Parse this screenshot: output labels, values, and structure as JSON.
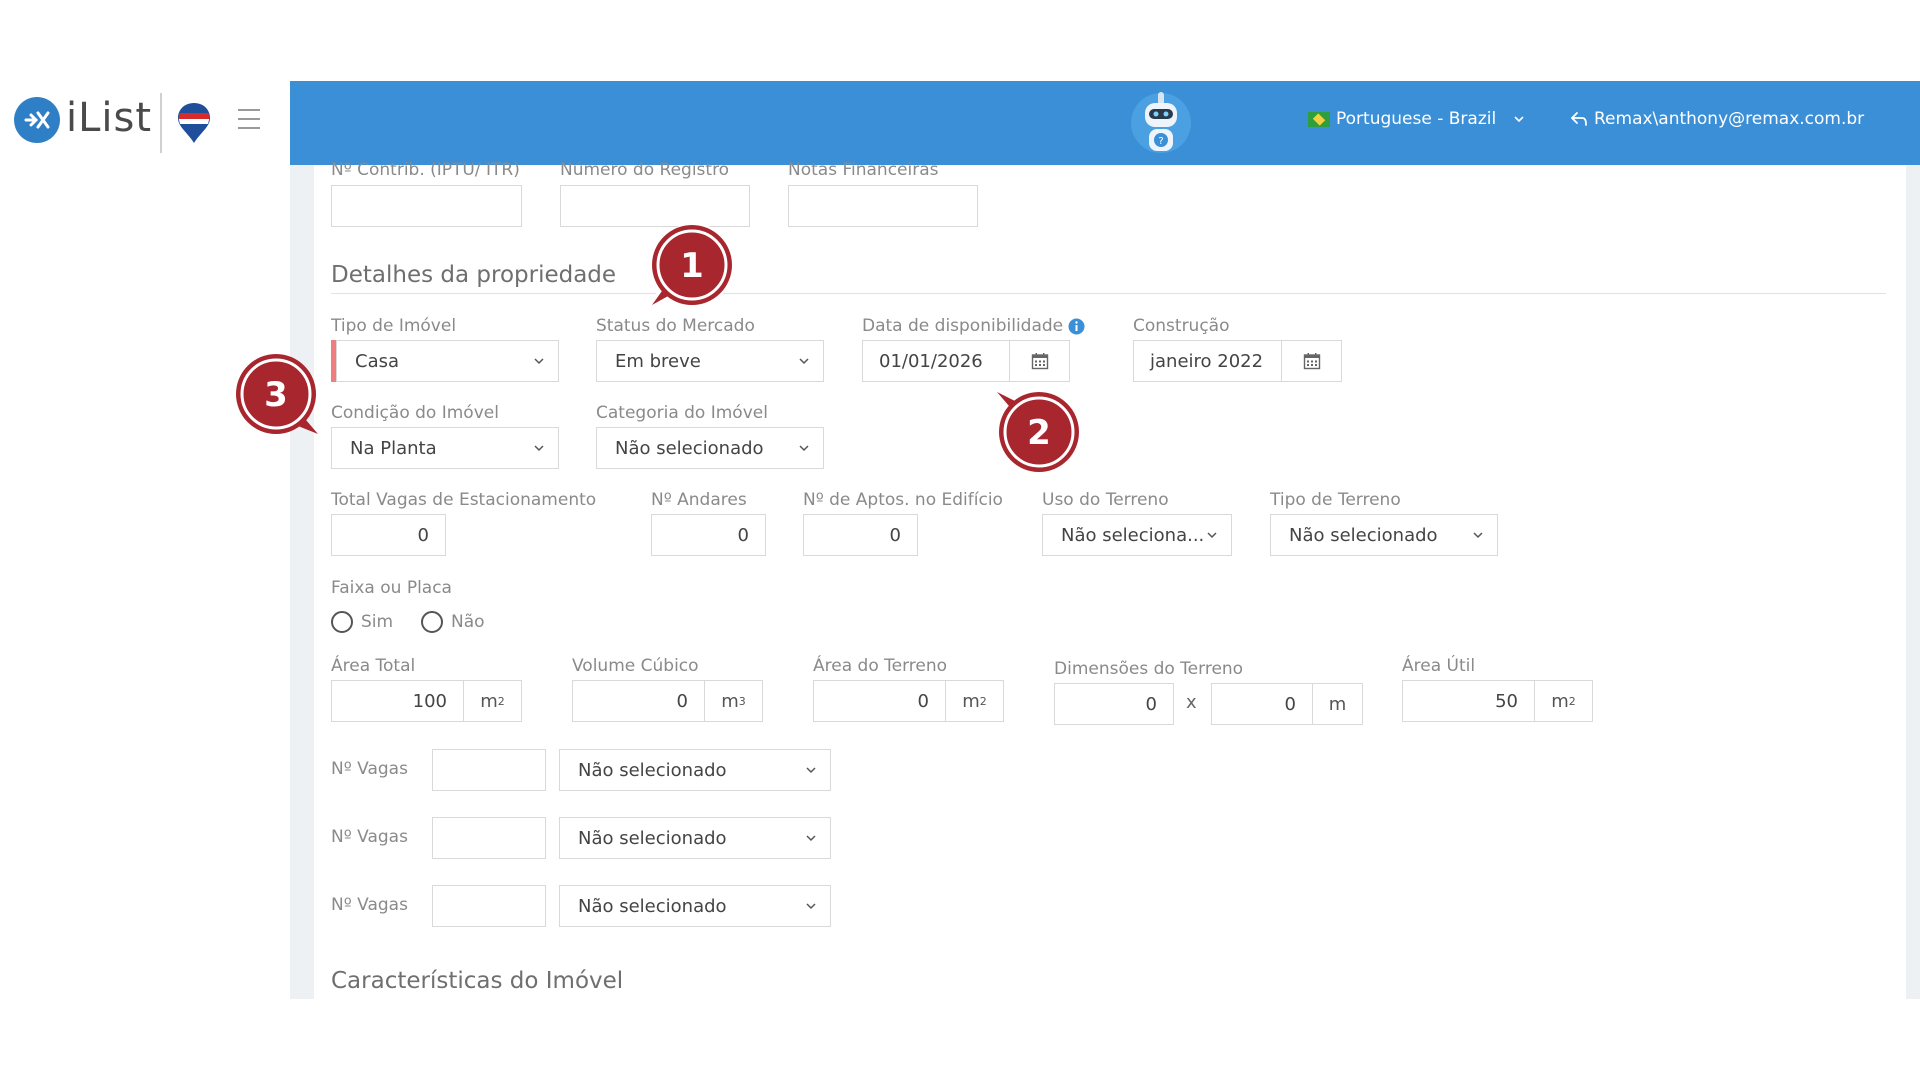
{
  "header": {
    "brand": "iList",
    "language": "Portuguese - Brazil",
    "user": "Remax\\anthony@remax.com.br"
  },
  "top_fields": {
    "contrib_label": "Nº Contrib. (IPTU/ ITR)",
    "registro_label": "Número do Registro",
    "notas_label": "Notas Financeiras"
  },
  "details": {
    "title": "Detalhes da propriedade",
    "tipo_label": "Tipo de Imóvel",
    "tipo_value": "Casa",
    "status_label": "Status do Mercado",
    "status_value": "Em breve",
    "disponibilidade_label": "Data de disponibilidade",
    "disponibilidade_value": "01/01/2026",
    "construcao_label": "Construção",
    "construcao_value": "janeiro 2022",
    "condicao_label": "Condição do Imóvel",
    "condicao_value": "Na Planta",
    "categoria_label": "Categoria do Imóvel",
    "categoria_value": "Não selecionado",
    "vagas_total_label": "Total Vagas de Estacionamento",
    "vagas_total_value": "0",
    "andares_label": "Nº Andares",
    "andares_value": "0",
    "aptos_label": "Nº de Aptos. no Edifício",
    "aptos_value": "0",
    "uso_label": "Uso do Terreno",
    "uso_value": "Não seleciona...",
    "tipo_terreno_label": "Tipo de Terreno",
    "tipo_terreno_value": "Não selecionado",
    "faixa_label": "Faixa ou Placa",
    "sim_label": "Sim",
    "nao_label": "Não",
    "area_total_label": "Área Total",
    "area_total_value": "100",
    "volume_label": "Volume Cúbico",
    "volume_value": "0",
    "area_terreno_label": "Área do Terreno",
    "area_terreno_value": "0",
    "dimensoes_label": "Dimensões do Terreno",
    "dim_a_value": "0",
    "dim_x": "x",
    "dim_b_value": "0",
    "dim_unit": "m",
    "area_util_label": "Área Útil",
    "area_util_value": "50",
    "unit_m": "m",
    "sup_2": "2",
    "sup_3": "3",
    "vagas_rows": [
      {
        "label": "Nº Vagas",
        "value": "",
        "select": "Não selecionado"
      },
      {
        "label": "Nº Vagas",
        "value": "",
        "select": "Não selecionado"
      },
      {
        "label": "Nº Vagas",
        "value": "",
        "select": "Não selecionado"
      }
    ]
  },
  "features": {
    "title": "Características do Imóvel"
  },
  "markers": {
    "m1": "1",
    "m2": "2",
    "m3": "3"
  },
  "colors": {
    "header": "#3a8fd6",
    "marker": "#a8262e",
    "required": "#f17e7e"
  }
}
